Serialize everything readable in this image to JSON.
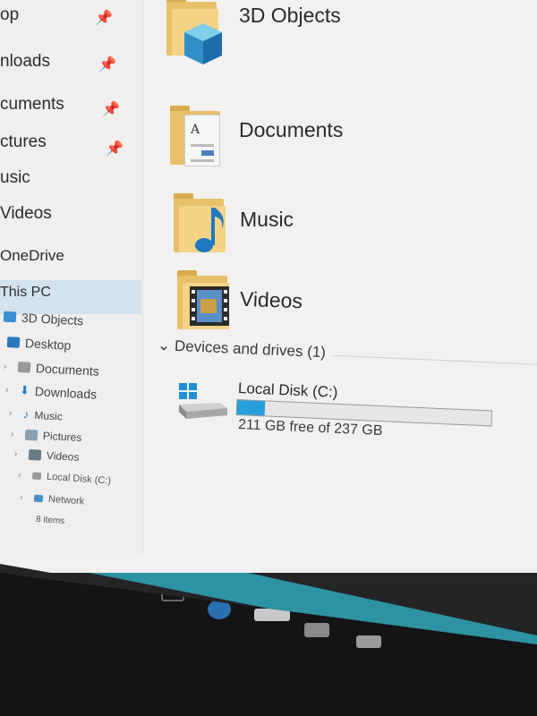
{
  "nav": {
    "quick_access": [
      {
        "label": "op",
        "pinned": true
      },
      {
        "label": "nloads",
        "pinned": true
      },
      {
        "label": "cuments",
        "pinned": true
      },
      {
        "label": "ctures",
        "pinned": true
      },
      {
        "label": "usic",
        "pinned": false
      },
      {
        "label": "Videos",
        "pinned": false
      }
    ],
    "onedrive": "OneDrive",
    "this_pc": "This PC",
    "tree": [
      {
        "label": "3D Objects"
      },
      {
        "label": "Desktop"
      },
      {
        "label": "Documents"
      },
      {
        "label": "Downloads"
      },
      {
        "label": "Music"
      },
      {
        "label": "Pictures"
      },
      {
        "label": "Videos"
      },
      {
        "label": "Local Disk (C:)"
      },
      {
        "label": "Network"
      }
    ],
    "status": "8 items"
  },
  "folders": [
    {
      "label": "3D Objects",
      "icon": "3d-cube-icon"
    },
    {
      "label": "Documents",
      "icon": "document-page-icon"
    },
    {
      "label": "Music",
      "icon": "music-note-icon"
    },
    {
      "label": "Videos",
      "icon": "film-strip-icon"
    }
  ],
  "devices": {
    "header": "Devices and drives (1)",
    "drives": [
      {
        "name": "Local Disk (C:)",
        "free_text": "211 GB free of 237 GB",
        "used_fraction": 0.11
      }
    ]
  },
  "colors": {
    "folder": "#f4d387",
    "selection": "#d2e2ef",
    "drive_bar": "#26a0da",
    "accent": "#2f9fb0"
  },
  "taskbar": {
    "icons": [
      "task-view-icon",
      "edge-icon",
      "file-explorer-icon",
      "store-icon",
      "mail-icon"
    ]
  }
}
